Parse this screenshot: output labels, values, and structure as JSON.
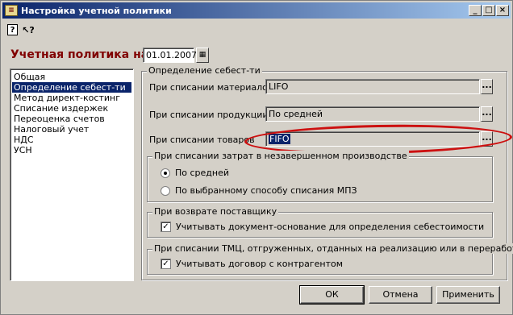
{
  "window": {
    "title": "Настройка учетной политики",
    "controls": [
      "_",
      "□",
      "×"
    ]
  },
  "toolbar": {
    "help_glyph": "?",
    "context_help_glyph": "↖?"
  },
  "heading": {
    "label": "Учетная политика на",
    "date": "01.01.2007"
  },
  "sections": [
    "Общая",
    "Определение себест-ти",
    "Метод директ-костинг",
    "Списание издержек",
    "Переоценка счетов",
    "Налоговый учет",
    "НДС",
    "УСН"
  ],
  "selected_section": "Определение себест-ти",
  "panel": {
    "title": "Определение себест-ти",
    "materials": {
      "label": "При списании материалов",
      "value": "LIFO"
    },
    "products": {
      "label": "При списании продукции",
      "value": "По средней"
    },
    "goods": {
      "label": "При списании товаров",
      "value": "FIFO"
    },
    "wip_group": {
      "title": "При списании затрат в незавершенном производстве",
      "option_avg": "По средней",
      "option_mpz": "По выбранному способу списания МПЗ",
      "selected": "По средней"
    },
    "return_group": {
      "title": "При возврате поставщику",
      "checkbox_label": "Учитывать документ-основание для определения себестоимости",
      "checked": true
    },
    "tmc_group": {
      "title": "При списании ТМЦ, отгруженных, отданных на реализацию или в переработку",
      "checkbox_label": "Учитывать договор с контрагентом",
      "checked": true
    }
  },
  "buttons": {
    "ok": "ОК",
    "cancel": "Отмена",
    "apply": "Применить",
    "ellipsis": "...",
    "calendar": "▦"
  },
  "annotation_color": "#cc1010"
}
